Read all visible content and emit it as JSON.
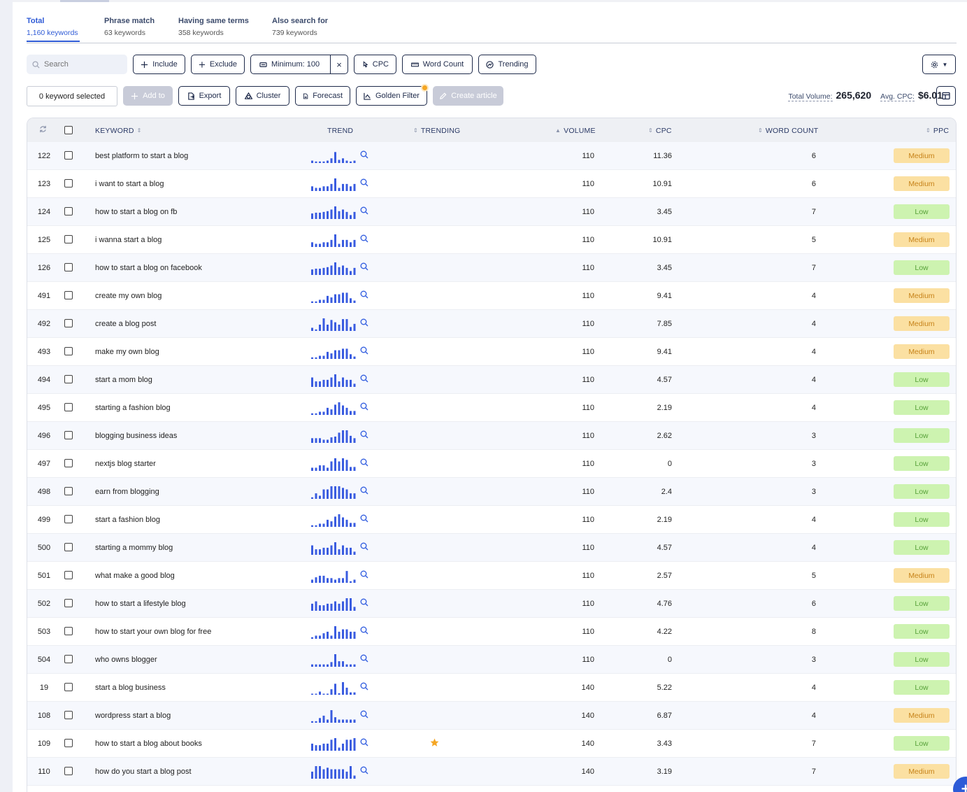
{
  "tabs": [
    {
      "label": "Total",
      "sub": "1,160 keywords",
      "active": true
    },
    {
      "label": "Phrase match",
      "sub": "63 keywords",
      "active": false
    },
    {
      "label": "Having same terms",
      "sub": "358 keywords",
      "active": false
    },
    {
      "label": "Also search for",
      "sub": "739 keywords",
      "active": false
    }
  ],
  "filters": {
    "search_placeholder": "Search",
    "include": "Include",
    "exclude": "Exclude",
    "minimum": "Minimum: 100",
    "cpc": "CPC",
    "word_count": "Word Count",
    "trending": "Trending"
  },
  "actions": {
    "selected": "0 keyword selected",
    "add_to": "Add to",
    "export": "Export",
    "cluster": "Cluster",
    "forecast": "Forecast",
    "golden_filter": "Golden Filter",
    "create_article": "Create article"
  },
  "totals": {
    "volume_label": "Total Volume:",
    "volume_value": "265,620",
    "cpc_label": "Avg. CPC:",
    "cpc_value": "$6.01"
  },
  "table": {
    "headers": {
      "keyword": "KEYWORD",
      "trend": "TREND",
      "trending": "TRENDING",
      "volume": "VOLUME",
      "cpc": "CPC",
      "word_count": "WORD COUNT",
      "ppc": "PPC"
    },
    "rows": [
      {
        "id": "122",
        "keyword": "best platform to start a blog",
        "volume": "110",
        "cpc": "11.36",
        "word_count": "6",
        "ppc": "Medium",
        "trending": false,
        "trend": [
          3,
          2,
          2,
          2,
          3,
          6,
          14,
          4,
          6,
          3,
          2,
          3
        ]
      },
      {
        "id": "123",
        "keyword": "i want to start a blog",
        "volume": "110",
        "cpc": "10.91",
        "word_count": "6",
        "ppc": "Medium",
        "trending": false,
        "trend": [
          6,
          4,
          4,
          6,
          6,
          9,
          16,
          4,
          9,
          9,
          6,
          9
        ]
      },
      {
        "id": "124",
        "keyword": "how to start a blog on fb",
        "volume": "110",
        "cpc": "3.45",
        "word_count": "7",
        "ppc": "Low",
        "trending": false,
        "trend": [
          7,
          8,
          8,
          9,
          10,
          12,
          16,
          10,
          12,
          9,
          5,
          9
        ]
      },
      {
        "id": "125",
        "keyword": "i wanna start a blog",
        "volume": "110",
        "cpc": "10.91",
        "word_count": "5",
        "ppc": "Medium",
        "trending": false,
        "trend": [
          6,
          4,
          4,
          6,
          6,
          9,
          16,
          4,
          9,
          9,
          6,
          9
        ]
      },
      {
        "id": "126",
        "keyword": "how to start a blog on facebook",
        "volume": "110",
        "cpc": "3.45",
        "word_count": "7",
        "ppc": "Low",
        "trending": false,
        "trend": [
          7,
          8,
          8,
          9,
          10,
          12,
          16,
          10,
          12,
          9,
          5,
          9
        ]
      },
      {
        "id": "491",
        "keyword": "create my own blog",
        "volume": "110",
        "cpc": "9.41",
        "word_count": "4",
        "ppc": "Medium",
        "trending": false,
        "trend": [
          2,
          2,
          4,
          4,
          9,
          7,
          11,
          11,
          13,
          13,
          6,
          3
        ]
      },
      {
        "id": "492",
        "keyword": "create a blog post",
        "volume": "110",
        "cpc": "7.85",
        "word_count": "4",
        "ppc": "Medium",
        "trending": false,
        "trend": [
          4,
          2,
          8,
          16,
          8,
          14,
          11,
          8,
          15,
          15,
          5,
          9
        ]
      },
      {
        "id": "493",
        "keyword": "make my own blog",
        "volume": "110",
        "cpc": "9.41",
        "word_count": "4",
        "ppc": "Medium",
        "trending": false,
        "trend": [
          2,
          2,
          4,
          4,
          9,
          7,
          11,
          11,
          13,
          13,
          6,
          3
        ]
      },
      {
        "id": "494",
        "keyword": "start a mom blog",
        "volume": "110",
        "cpc": "4.57",
        "word_count": "4",
        "ppc": "Low",
        "trending": false,
        "trend": [
          12,
          7,
          7,
          9,
          9,
          12,
          16,
          7,
          12,
          9,
          9,
          4
        ]
      },
      {
        "id": "495",
        "keyword": "starting a fashion blog",
        "volume": "110",
        "cpc": "2.19",
        "word_count": "4",
        "ppc": "Low",
        "trending": false,
        "trend": [
          2,
          2,
          4,
          4,
          9,
          7,
          13,
          16,
          12,
          9,
          5,
          5
        ]
      },
      {
        "id": "496",
        "keyword": "blogging business ideas",
        "volume": "110",
        "cpc": "2.62",
        "word_count": "3",
        "ppc": "Low",
        "trending": false,
        "trend": [
          6,
          6,
          6,
          4,
          4,
          7,
          8,
          13,
          16,
          16,
          9,
          6
        ]
      },
      {
        "id": "497",
        "keyword": "nextjs blog starter",
        "volume": "110",
        "cpc": "0",
        "word_count": "3",
        "ppc": "Low",
        "trending": false,
        "trend": [
          4,
          4,
          7,
          7,
          4,
          12,
          16,
          12,
          16,
          14,
          5,
          5
        ]
      },
      {
        "id": "498",
        "keyword": "earn from blogging",
        "volume": "110",
        "cpc": "2.4",
        "word_count": "3",
        "ppc": "Low",
        "trending": false,
        "trend": [
          2,
          7,
          4,
          12,
          12,
          16,
          16,
          16,
          14,
          12,
          7,
          7
        ]
      },
      {
        "id": "499",
        "keyword": "start a fashion blog",
        "volume": "110",
        "cpc": "2.19",
        "word_count": "4",
        "ppc": "Low",
        "trending": false,
        "trend": [
          2,
          2,
          4,
          4,
          9,
          7,
          13,
          16,
          12,
          9,
          5,
          5
        ]
      },
      {
        "id": "500",
        "keyword": "starting a mommy blog",
        "volume": "110",
        "cpc": "4.57",
        "word_count": "4",
        "ppc": "Low",
        "trending": false,
        "trend": [
          12,
          7,
          7,
          9,
          9,
          12,
          16,
          7,
          12,
          9,
          9,
          4
        ]
      },
      {
        "id": "501",
        "keyword": "what make a good blog",
        "volume": "110",
        "cpc": "2.57",
        "word_count": "5",
        "ppc": "Medium",
        "trending": false,
        "trend": [
          4,
          7,
          9,
          9,
          6,
          6,
          4,
          6,
          6,
          15,
          2,
          4
        ]
      },
      {
        "id": "502",
        "keyword": "how to start a lifestyle blog",
        "volume": "110",
        "cpc": "4.76",
        "word_count": "6",
        "ppc": "Low",
        "trending": false,
        "trend": [
          9,
          12,
          7,
          7,
          9,
          9,
          12,
          9,
          12,
          16,
          16,
          5
        ]
      },
      {
        "id": "503",
        "keyword": "how to start your own blog for free",
        "volume": "110",
        "cpc": "4.22",
        "word_count": "8",
        "ppc": "Low",
        "trending": false,
        "trend": [
          2,
          4,
          4,
          7,
          9,
          4,
          16,
          9,
          12,
          12,
          9,
          9
        ]
      },
      {
        "id": "504",
        "keyword": "who owns blogger",
        "volume": "110",
        "cpc": "0",
        "word_count": "3",
        "ppc": "Low",
        "trending": false,
        "trend": [
          3,
          3,
          3,
          3,
          3,
          6,
          16,
          7,
          7,
          3,
          3,
          3
        ]
      },
      {
        "id": "19",
        "keyword": "start a blog business",
        "volume": "140",
        "cpc": "5.22",
        "word_count": "4",
        "ppc": "Low",
        "trending": false,
        "trend": [
          1,
          1,
          4,
          1,
          1,
          7,
          14,
          2,
          16,
          9,
          3,
          3
        ]
      },
      {
        "id": "108",
        "keyword": "wordpress start a blog",
        "volume": "140",
        "cpc": "6.87",
        "word_count": "4",
        "ppc": "Medium",
        "trending": false,
        "trend": [
          2,
          2,
          6,
          9,
          4,
          16,
          7,
          4,
          4,
          4,
          4,
          4
        ]
      },
      {
        "id": "109",
        "keyword": "how to start a blog about books",
        "volume": "140",
        "cpc": "3.43",
        "word_count": "7",
        "ppc": "Low",
        "trending": true,
        "trend": [
          9,
          7,
          7,
          9,
          9,
          14,
          16,
          4,
          9,
          14,
          14,
          16
        ]
      },
      {
        "id": "110",
        "keyword": "how do you start a blog post",
        "volume": "140",
        "cpc": "3.19",
        "word_count": "7",
        "ppc": "Medium",
        "trending": false,
        "trend": [
          9,
          16,
          16,
          12,
          14,
          12,
          12,
          12,
          12,
          9,
          16,
          4
        ]
      }
    ]
  }
}
